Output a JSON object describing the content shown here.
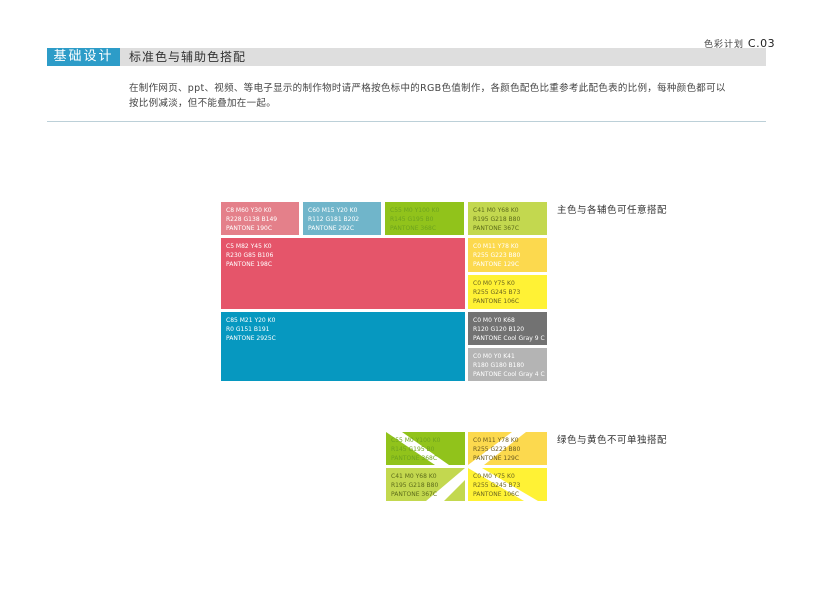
{
  "header": {
    "page_label": "色彩计划",
    "page_code": "C.03",
    "section": "基础设计",
    "title": "标准色与辅助色搭配"
  },
  "intro": {
    "line1": "在制作网页、ppt、视频、等电子显示的制作物时请严格按色标中的RGB色值制作，各颜色配色比重参考此配色表的比例，每种颜色都可以",
    "line2": "按比例减淡，但不能叠加在一起。"
  },
  "colors": {
    "pink": {
      "hex": "#e4808a",
      "cmyk": "C8 M60 Y30 K0",
      "rgb": "R228 G138 B149",
      "pantone": "PANTONE 190C"
    },
    "lblue": {
      "hex": "#70b5ca",
      "cmyk": "C60 M15 Y20 K0",
      "rgb": "R112 G181 B202",
      "pantone": "PANTONE 292C"
    },
    "green": {
      "hex": "#91c31b",
      "cmyk": "C55 M0 Y100 K0",
      "rgb": "R145 G195 B0",
      "pantone": "PANTONE 368C"
    },
    "lgreen": {
      "hex": "#c3d84f",
      "cmyk": "C41 M0 Y68 K0",
      "rgb": "R195 G218 B80",
      "pantone": "PANTONE 367C"
    },
    "red": {
      "hex": "#e5556a",
      "cmyk": "C5 M82 Y45 K0",
      "rgb": "R230 G85 B106",
      "pantone": "PANTONE 198C"
    },
    "gold": {
      "hex": "#fcd94e",
      "cmyk": "C0 M11 Y78 K0",
      "rgb": "R255 G223 B80",
      "pantone": "PANTONE 129C"
    },
    "yellow": {
      "hex": "#fff235",
      "cmyk": "C0 M0 Y75 K0",
      "rgb": "R255 G245 B73",
      "pantone": "PANTONE 106C"
    },
    "blue": {
      "hex": "#0698c0",
      "cmyk": "C85 M21 Y20 K0",
      "rgb": "R0 G151 B191",
      "pantone": "PANTONE 2925C"
    },
    "dgray": {
      "hex": "#727272",
      "cmyk": "C0 M0 Y0 K68",
      "rgb": "R120 G120 B120",
      "pantone": "PANTONE Cool Gray 9 C"
    },
    "lgray": {
      "hex": "#b4b4b4",
      "cmyk": "C0 M0 Y0 K41",
      "rgb": "R180 G180 B180",
      "pantone": "PANTONE Cool Gray 4 C"
    }
  },
  "labels": {
    "main_combo": "主色与各辅色可任意搭配",
    "forbidden_combo": "绿色与黄色不可单独搭配"
  }
}
